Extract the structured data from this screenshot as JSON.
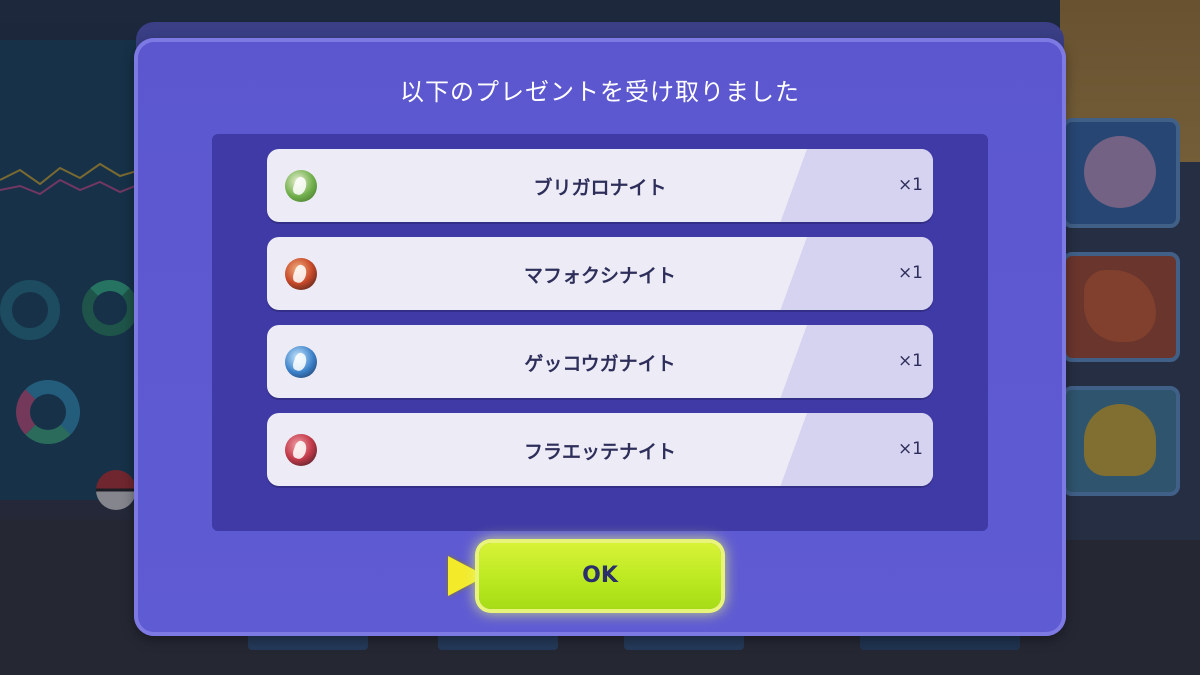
{
  "dialog": {
    "title": "以下のプレゼントを受け取りました",
    "items": [
      {
        "name": "ブリガロナイト",
        "quantity": "×1",
        "icon": "brigaronite-stone-icon",
        "stone_color": "#6fae4a"
      },
      {
        "name": "マフォクシナイト",
        "quantity": "×1",
        "icon": "mafokushinite-stone-icon",
        "stone_color": "#c94a2a"
      },
      {
        "name": "ゲッコウガナイト",
        "quantity": "×1",
        "icon": "gekkouganite-stone-icon",
        "stone_color": "#3a7fc8"
      },
      {
        "name": "フラエッテナイト",
        "quantity": "×1",
        "icon": "floettenite-stone-icon",
        "stone_color": "#c43a4a"
      }
    ],
    "ok_label": "OK"
  },
  "colors": {
    "dialog_bg": "#5f5bd3",
    "list_panel_bg": "#3f3aa6",
    "item_bg": "#ecebf6",
    "ok_button": "#b9e81f",
    "cursor": "#f3ea2a"
  }
}
